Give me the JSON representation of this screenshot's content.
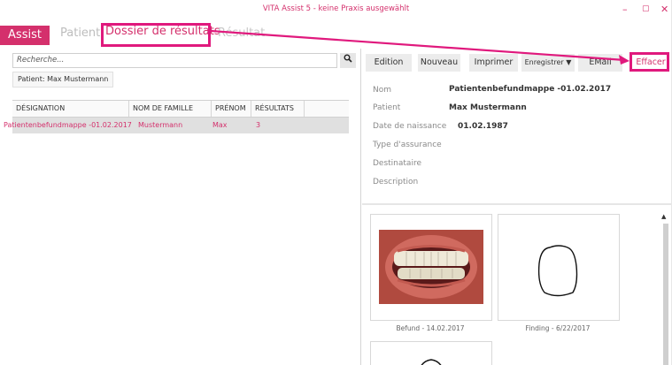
{
  "window": {
    "title": "VITA Assist 5 - keine Praxis ausgewählt",
    "minimize": "–",
    "maximize": "▢",
    "close": "✕"
  },
  "tabs": [
    {
      "label": "Assist"
    },
    {
      "label": "Patient"
    },
    {
      "label": "Dossier de résultats"
    },
    {
      "label": "Résultat"
    }
  ],
  "search": {
    "placeholder": "Recherche...",
    "icon": "search-icon"
  },
  "patient_chip": "Patient: Max Mustermann",
  "table": {
    "headers": [
      "DÉSIGNATION",
      "NOM DE FAMILLE",
      "PRÉNOM",
      "RÉSULTATS"
    ],
    "rows": [
      {
        "designation": "Patientenbefundmappe -01.02.2017",
        "nom": "Mustermann",
        "prenom": "Max",
        "resultats": "3"
      }
    ]
  },
  "toolbar": {
    "edition": "Edition",
    "nouveau": "Nouveau",
    "imprimer": "Imprimer",
    "enregistrer": "Enregistrer",
    "email": "EMail",
    "effacer": "Effacer"
  },
  "details": {
    "nom_label": "Nom",
    "nom_value": "Patientenbefundmappe -01.02.2017",
    "patient_label": "Patient",
    "patient_value": "Max Mustermann",
    "dob_label": "Date de naissance",
    "dob_value": "01.02.1987",
    "assurance_label": "Type d'assurance",
    "destinataire_label": "Destinataire",
    "description_label": "Description"
  },
  "thumbnails": [
    {
      "caption": "Befund - 14.02.2017"
    },
    {
      "caption": "Finding - 6/22/2017"
    }
  ],
  "colors": {
    "accent": "#d4306c",
    "highlight": "#e0197d"
  }
}
